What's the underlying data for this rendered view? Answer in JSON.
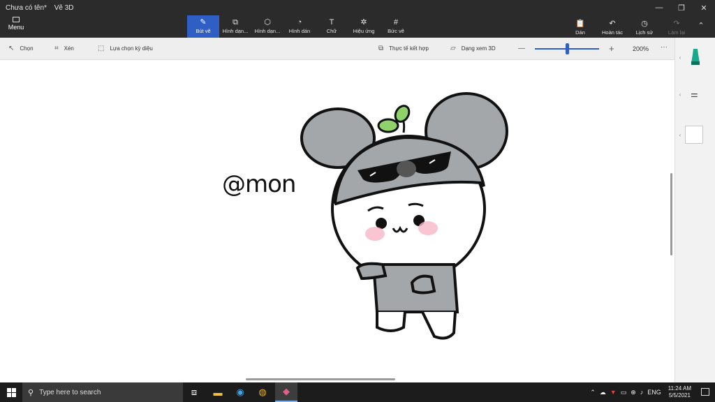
{
  "window": {
    "title": "Chưa có tên*",
    "app_name": "Vẽ 3D"
  },
  "menu": {
    "label": "Menu"
  },
  "ribbon": {
    "tools": [
      {
        "label": "Bút vẽ",
        "active": true
      },
      {
        "label": "Hình dạn..."
      },
      {
        "label": "Hình dạn..."
      },
      {
        "label": "Hình dán"
      },
      {
        "label": "Chữ"
      },
      {
        "label": "Hiệu ứng"
      },
      {
        "label": "Bức vẽ"
      }
    ],
    "right": {
      "paste": "Dán",
      "undo": "Hoàn tác",
      "history": "Lịch sử",
      "redo": "Làm lại"
    }
  },
  "toolbar": {
    "select": "Chọn",
    "crop": "Xén",
    "magic_select": "Lựa chọn kỳ diệu",
    "mixed_reality": "Thực tế kết hợp",
    "view_3d": "Dạng xem 3D",
    "zoom_level": "200%",
    "zoom_fraction": 0.5
  },
  "canvas": {
    "signature": "@mon"
  },
  "taskbar": {
    "search_placeholder": "Type here to search",
    "language": "ENG",
    "time": "11:24 AM",
    "date": "5/5/2021"
  },
  "colors": {
    "accent": "#2f5ec4",
    "titlebar": "#2b2b2b",
    "toolbar": "#eeeeee",
    "taskbar": "#1c1c1c",
    "koala_gray": "#a4a7aa",
    "blush": "#f7b6c8",
    "sprout": "#8fd16a"
  }
}
